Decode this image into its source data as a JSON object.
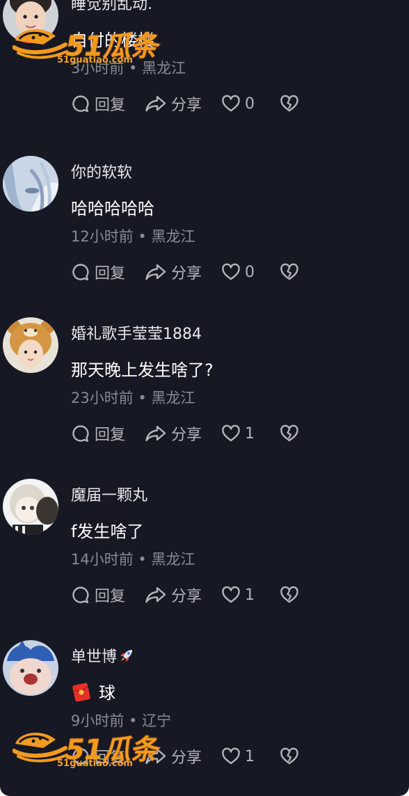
{
  "colors": {
    "background": "#161823",
    "text_primary": "#ffffff",
    "text_secondary": "#8a8b93",
    "action_gray": "#b4b5bb",
    "watermark_orange": "#f29a1f"
  },
  "watermark": {
    "brand": "51瓜条",
    "url": "51guatiao.com"
  },
  "actions": {
    "reply_label": "回复",
    "share_label": "分享",
    "reply_icon": "comment-bubble-icon",
    "share_icon": "share-arrow-icon",
    "like_icon": "heart-icon",
    "dislike_icon": "broken-heart-icon"
  },
  "comments": [
    {
      "username": "睡觉别乱动.",
      "content": "自付的楼楼",
      "time": "3小时前",
      "location": "黑龙江",
      "likes": "0",
      "avatar": "boy-avatar"
    },
    {
      "username": "你的软软",
      "content": "哈哈哈哈哈",
      "time": "12小时前",
      "location": "黑龙江",
      "likes": "0",
      "avatar": "anime-girl-avatar"
    },
    {
      "username": "婚礼歌手莹莹1884",
      "content": "那天晚上发生啥了?",
      "time": "23小时前",
      "location": "黑龙江",
      "likes": "1",
      "avatar": "bear-hat-avatar"
    },
    {
      "username": "魔届一颗丸",
      "content": "f发生啥了",
      "time": "14小时前",
      "location": "黑龙江",
      "likes": "1",
      "avatar": "doll-avatar"
    },
    {
      "username": "单世博",
      "username_emoji": "rocket-icon",
      "content": "球",
      "content_emoji": "red-envelope-icon",
      "time": "9小时前",
      "location": "辽宁",
      "likes": "1",
      "avatar": "blue-hat-avatar"
    }
  ]
}
